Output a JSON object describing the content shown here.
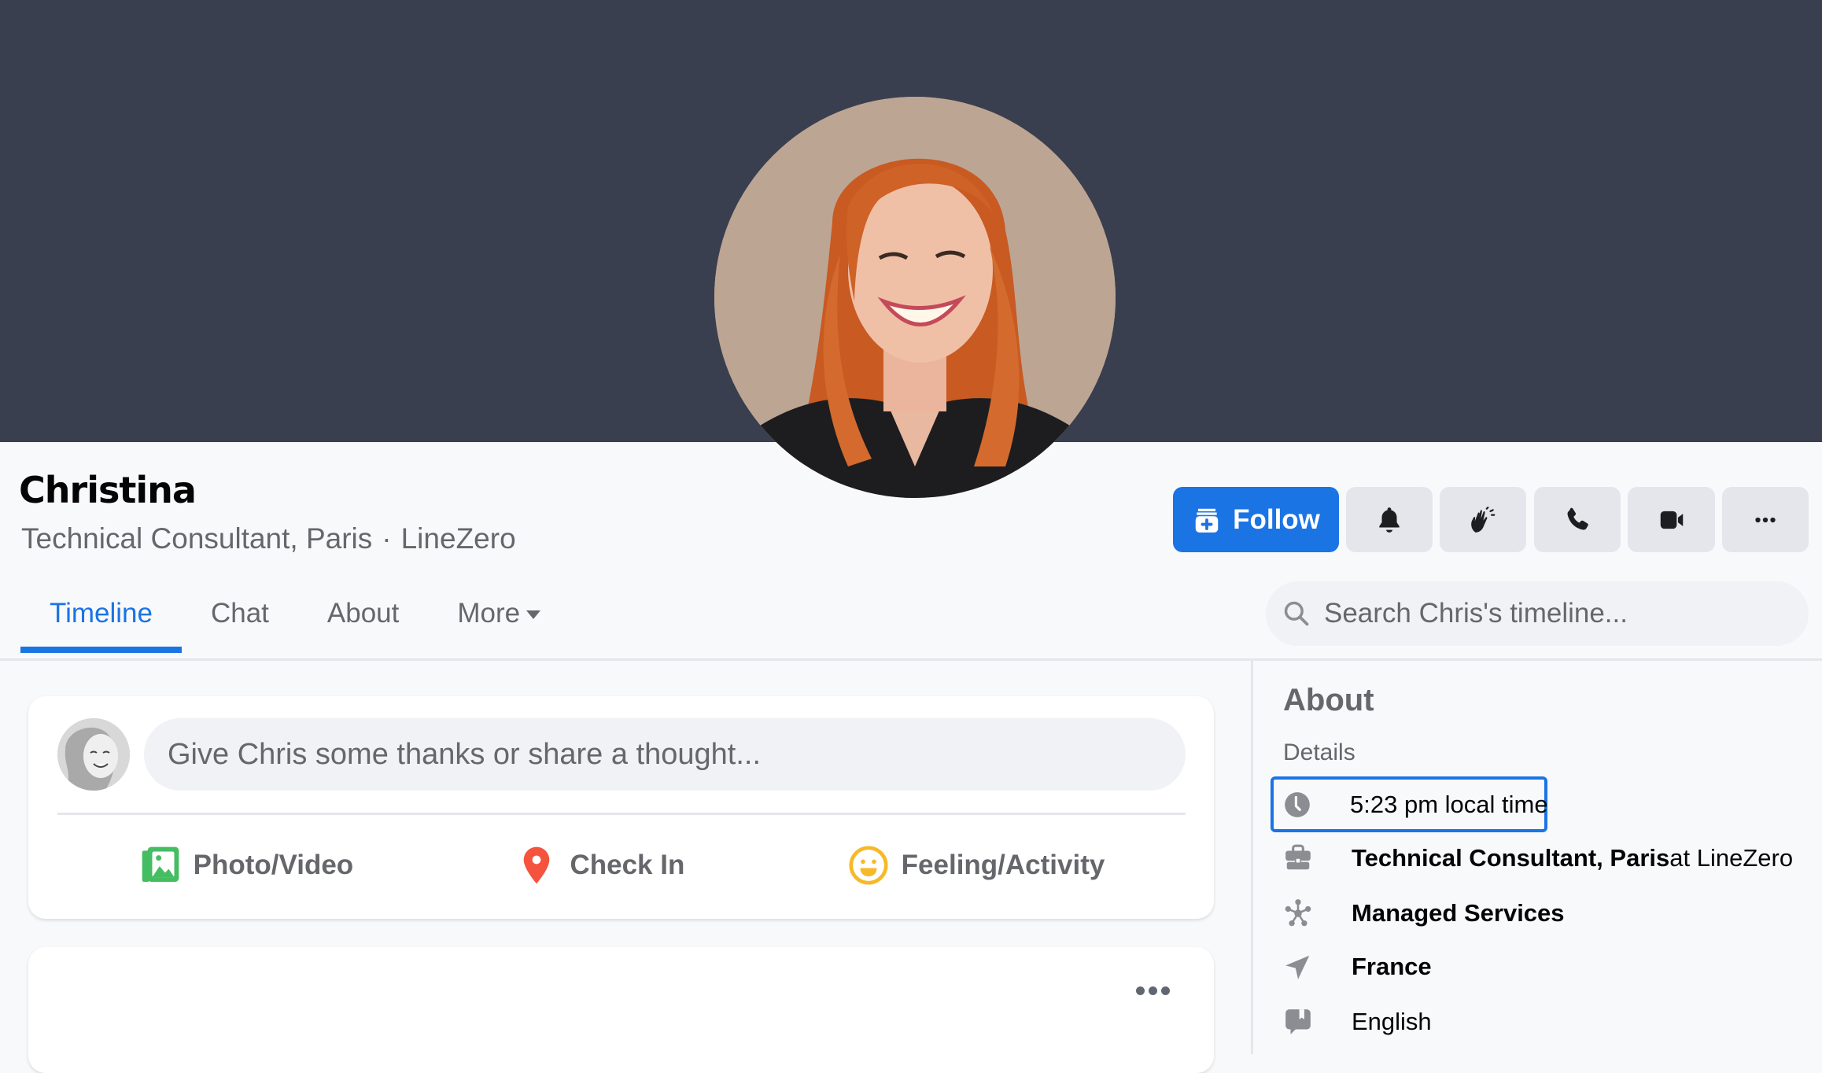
{
  "profile": {
    "name": "Christina",
    "subtitle_role": "Technical Consultant, Paris",
    "subtitle_separator": "·",
    "subtitle_company": "LineZero"
  },
  "colors": {
    "cover": "#3a3f4f",
    "accent": "#1b74e4",
    "button_bg": "#e4e6eb",
    "muted_text": "#65676b",
    "photo_icon": "#45bd62",
    "checkin_icon": "#f5533d",
    "feeling_icon": "#f7b928"
  },
  "tabs": [
    {
      "label": "Timeline",
      "active": true
    },
    {
      "label": "Chat",
      "active": false
    },
    {
      "label": "About",
      "active": false
    },
    {
      "label": "More",
      "active": false,
      "has_dropdown": true
    }
  ],
  "actions": {
    "follow_label": "Follow",
    "buttons": [
      {
        "icon": "bell-icon",
        "label": "Notifications"
      },
      {
        "icon": "wave-hands-icon",
        "label": "Say thanks"
      },
      {
        "icon": "phone-icon",
        "label": "Call"
      },
      {
        "icon": "video-camera-icon",
        "label": "Video call"
      },
      {
        "icon": "more-icon",
        "label": "More"
      }
    ]
  },
  "search": {
    "placeholder": "Search Chris's timeline...",
    "value": ""
  },
  "composer": {
    "placeholder": "Give Chris some thanks or share a thought...",
    "value": "",
    "actions": [
      {
        "icon": "photo-icon",
        "label": "Photo/Video"
      },
      {
        "icon": "location-pin-icon",
        "label": "Check In"
      },
      {
        "icon": "smiley-icon",
        "label": "Feeling/Activity"
      }
    ]
  },
  "about": {
    "title": "About",
    "details_label": "Details",
    "items": [
      {
        "icon": "clock-icon",
        "text": "5:23 pm local time",
        "focused": true
      },
      {
        "icon": "briefcase-icon",
        "bold": "Technical Consultant, Paris",
        "suffix": " at LineZero"
      },
      {
        "icon": "org-network-icon",
        "bold": "Managed Services"
      },
      {
        "icon": "location-arrow-icon",
        "bold": "France"
      },
      {
        "icon": "language-icon",
        "text": "English"
      }
    ]
  }
}
